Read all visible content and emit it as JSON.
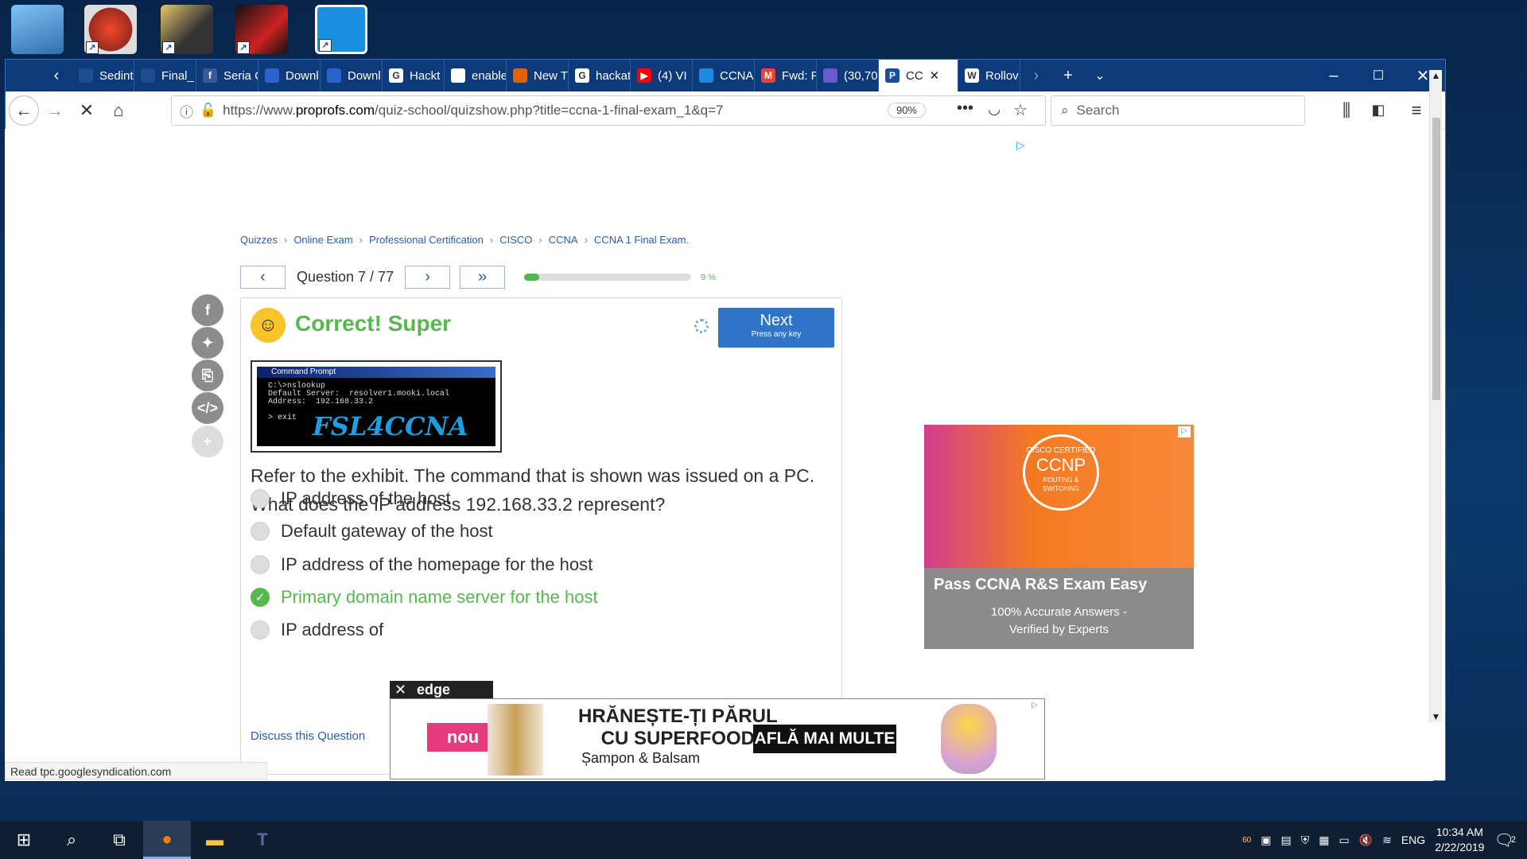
{
  "browser": {
    "tabs": [
      {
        "label": "Sedint",
        "color": "#1e4d8c"
      },
      {
        "label": "Final_",
        "color": "#1e4d8c"
      },
      {
        "label": "Seria C",
        "color": "#3b5998",
        "glyph": "f"
      },
      {
        "label": "Downl",
        "color": "#2a63c9"
      },
      {
        "label": "Downl",
        "color": "#2a63c9"
      },
      {
        "label": "Hackt",
        "color": "#ffffff",
        "glyph": "G"
      },
      {
        "label": "enable",
        "color": "#ffffff"
      },
      {
        "label": "New T",
        "color": "#e66000"
      },
      {
        "label": "hackat",
        "color": "#ffffff",
        "glyph": "G"
      },
      {
        "label": "(4) VI",
        "color": "#ff0000",
        "glyph": "▶"
      },
      {
        "label": "CCNA",
        "color": "#1e88e5"
      },
      {
        "label": "Fwd: F",
        "color": "#ea4335",
        "glyph": "M"
      },
      {
        "label": "(30,70",
        "color": "#6a5acd"
      },
      {
        "label": "CC",
        "color": "#1a4da1",
        "glyph": "P",
        "active": true
      },
      {
        "label": "Rollov",
        "color": "#ffffff",
        "glyph": "W"
      }
    ],
    "url_prefix": "https://www.",
    "url_domain": "proprofs.com",
    "url_path": "/quiz-school/quizshow.php?title=ccna-1-final-exam_1&q=7",
    "zoom": "90%",
    "search_placeholder": "Search",
    "status": "Read tpc.googlesyndication.com"
  },
  "breadcrumbs": [
    "Quizzes",
    "Online Exam",
    "Professional Certification",
    "CISCO",
    "CCNA",
    "CCNA 1 Final Exam."
  ],
  "quiz": {
    "question_label": "Question 7 / 77",
    "progress_percent": 9,
    "progress_text": "9 %",
    "result": "Correct! Super",
    "next_label": "Next",
    "next_sub": "Press any key",
    "exhibit_title": "Command Prompt",
    "exhibit_text": "C:\\>nslookup\nDefault Server:  resolver1.mooki.local\nAddress:  192.168.33.2\n\n> exit",
    "exhibit_logo": "FSL4CCNA",
    "question": "Refer to the exhibit. The command that is shown was issued on a PC. What does the IP address 192.168.33.2   represent?",
    "options": [
      {
        "text": "IP address of the host",
        "selected": false
      },
      {
        "text": "Default gateway of the host",
        "selected": false
      },
      {
        "text": "IP address of the homepage for the host",
        "selected": false
      },
      {
        "text": "Primary domain name server for the host",
        "selected": true
      },
      {
        "text": "IP address of",
        "selected": false
      }
    ],
    "discuss": "Discuss this Question"
  },
  "ad_side": {
    "badge_top": "CISCO CERTIFIED",
    "badge_main": "CCNP",
    "badge_sub": "ROUTING & SWITCHING",
    "headline": "Pass CCNA R&S Exam Easy",
    "sub1": "100% Accurate Answers -",
    "sub2": "Verified by Experts"
  },
  "ad_bottom": {
    "tag": "edge",
    "nou": "nou",
    "line1": "HRĂNEȘTE-ȚI PĂRUL",
    "line2": "CU SUPERFOOD",
    "line3": "Șampon & Balsam",
    "cta": "AFLĂ MAI MULTE"
  },
  "taskbar": {
    "lang": "ENG",
    "time": "10:34 AM",
    "date": "2/22/2019",
    "notif_count": "2",
    "tray_num": "60"
  }
}
